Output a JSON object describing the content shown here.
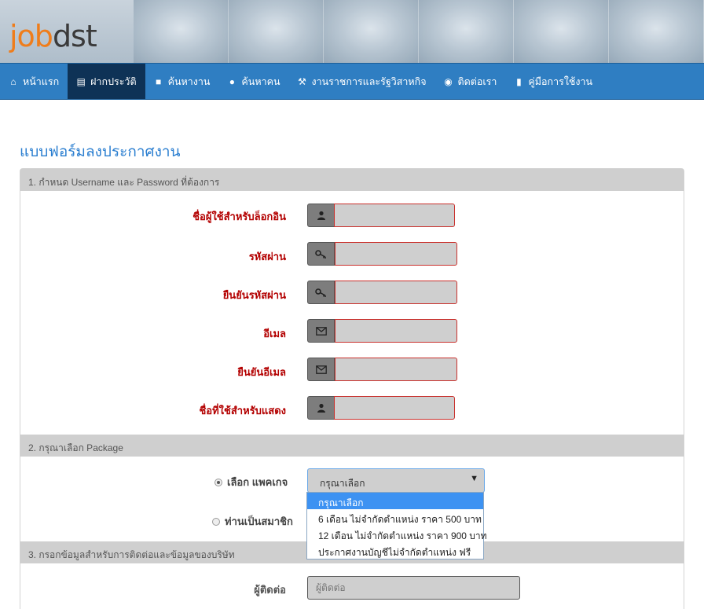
{
  "brand": {
    "logo_part1": "job",
    "logo_part2": "dst",
    "accent": "#ef7d1b",
    "nav_color": "#2f7ec2"
  },
  "nav": [
    {
      "label": "หน้าแรก",
      "icon": "home-icon"
    },
    {
      "label": "ฝากประวัติ",
      "icon": "file-icon",
      "active": true
    },
    {
      "label": "ค้นหางาน",
      "icon": "briefcase-icon"
    },
    {
      "label": "ค้นหาคน",
      "icon": "user-icon"
    },
    {
      "label": "งานราชการและรัฐวิสาหกิจ",
      "icon": "gavel-icon"
    },
    {
      "label": "ติดต่อเรา",
      "icon": "globe-icon"
    },
    {
      "label": "คู่มือการใช้งาน",
      "icon": "book-icon"
    }
  ],
  "page_title": "แบบฟอร์มลงประกาศงาน",
  "sections": {
    "s1": "1. กำหนด Username และ Password ที่ต้องการ",
    "s2": "2. กรุณาเลือก Package",
    "s3": "3. กรอกข้อมูลสำหรับการติดต่อและข้อมูลของบริษัท"
  },
  "fields": {
    "username": {
      "label": "ชื่อผู้ใช้สำหรับล็อกอิน",
      "icon": "user-icon",
      "value": ""
    },
    "password": {
      "label": "รหัสผ่าน",
      "icon": "key-icon",
      "value": ""
    },
    "confirm_password": {
      "label": "ยืนยันรหัสผ่าน",
      "icon": "key-icon",
      "value": ""
    },
    "email": {
      "label": "อีเมล",
      "icon": "envelope-icon",
      "value": ""
    },
    "confirm_email": {
      "label": "ยืนยันอีเมล",
      "icon": "envelope-icon",
      "value": ""
    },
    "display_name": {
      "label": "ชื่อที่ใช้สำหรับแสดง",
      "icon": "user-icon",
      "value": ""
    }
  },
  "package": {
    "radio_select_label": "เลือก แพคเกจ",
    "radio_member_label": "ท่านเป็นสมาชิก",
    "selected": "กรุณาเลือก",
    "options": [
      "กรุณาเลือก",
      "6 เดือน ไม่จำกัดตำแหน่ง ราคา 500 บาท",
      "12 เดือน ไม่จำกัดตำแหน่ง ราคา 900 บาท",
      "ประกาศงานบัญชีไม่จำกัดตำแหน่ง ฟรี"
    ]
  },
  "contact": {
    "label": "ผู้ติดต่อ",
    "placeholder": "ผู้ติดต่อ"
  }
}
